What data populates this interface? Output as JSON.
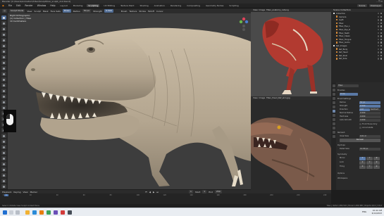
{
  "titlebar": {
    "title": "Blender [C:\\Users\\Animation\\T-Rex\\Sculpt\\trex_sculpt_v12.blend]",
    "controls": "–  ❐  ✕"
  },
  "menubar": {
    "menus": [
      "File",
      "Edit",
      "Render",
      "Window",
      "Help"
    ],
    "workspaces": [
      "Layout",
      "Modeling",
      "Sculpting",
      "UV Editing",
      "Texture Paint",
      "Shading",
      "Animation",
      "Rendering",
      "Compositing",
      "Geometry Nodes",
      "Scripting"
    ],
    "active_workspace": "Sculpting",
    "scene": "Scene",
    "view_layer": "ViewLayer"
  },
  "viewport_header": {
    "mode": "Sculpt Mode",
    "items": [
      "View",
      "Sculpt",
      "Mask",
      "Face Sets"
    ],
    "brush": "Draw",
    "radius_label": "Radius",
    "radius": "50 px",
    "strength_label": "Strength",
    "strength": "0.500",
    "right_items": [
      "Brush",
      "Texture",
      "Stroke",
      "Falloff",
      "Cursor"
    ]
  },
  "viewport_overlay": {
    "view": "Right Orthographic",
    "collection": "(1) Collection | TRex",
    "units": "10 Centimeters"
  },
  "reference_images": [
    {
      "name": "TRex_anatomy_ref.png",
      "view": "View",
      "image": "Image"
    },
    {
      "name": "TRex_Head_Ref_skin.jpg",
      "view": "View",
      "image": "Image"
    }
  ],
  "outliner": {
    "title": "Scene Collection",
    "items": [
      {
        "label": "Collection",
        "depth": 0
      },
      {
        "label": "Camera",
        "depth": 1
      },
      {
        "label": "Light",
        "depth": 1
      },
      {
        "label": "TRex",
        "depth": 1
      },
      {
        "label": "TRex_Eye_L",
        "depth": 1
      },
      {
        "label": "TRex_Eye_R",
        "depth": 1
      },
      {
        "label": "TRex_Teeth",
        "depth": 1
      },
      {
        "label": "TRex_Claws",
        "depth": 1
      },
      {
        "label": "TRex_Tongue",
        "depth": 1
      },
      {
        "label": "TRex_Gums",
        "depth": 1
      },
      {
        "label": "Ref_Images",
        "depth": 0
      },
      {
        "label": "Ref_Body",
        "depth": 1
      },
      {
        "label": "Ref_Head",
        "depth": 1
      },
      {
        "label": "Ref_Skull",
        "depth": 1
      },
      {
        "label": "Ref_Side",
        "depth": 1
      }
    ]
  },
  "properties": {
    "object_name": "TRex",
    "brush_name": "Draw",
    "sections": {
      "brushes": "Brushes",
      "brush_settings": "Brush Settings",
      "remesh": "Remesh",
      "dyntopo": "Dyntopo",
      "symmetry": "Symmetry",
      "options": "Options",
      "workspace": "Workspace"
    },
    "fields": {
      "radius_label": "Radius",
      "radius": "50 px",
      "strength_label": "Strength",
      "strength": "0.500",
      "direction_label": "Direction",
      "add": "Add",
      "subtract": "Subtract",
      "normal_radius_label": "Normal Radius",
      "normal_radius": "0.500",
      "hardness_label": "Hardness",
      "hardness": "0.000",
      "autosmooth_label": "Auto-Smooth",
      "autosmooth": "0.000",
      "front_faces": "Front Faces Only",
      "accumulate": "Accumulate",
      "voxel_size_label": "Voxel Size",
      "voxel_size": "0.01 m",
      "remesh_button": "Remesh",
      "detail_size_label": "Detail Size",
      "detail_size": "12.00 px",
      "mirror_label": "Mirror",
      "x": "X",
      "y": "Y",
      "z": "Z",
      "lock_label": "Lock",
      "tiling_label": "Tiling"
    }
  },
  "timeline": {
    "items": [
      "Playback",
      "Keying",
      "View",
      "Marker"
    ],
    "current_frame": "1",
    "start_label": "Start",
    "start": "1",
    "end_label": "End",
    "end": "250",
    "ticks": [
      "0",
      "20",
      "40",
      "60",
      "80",
      "100",
      "120",
      "140",
      "160",
      "180",
      "200",
      "220",
      "240"
    ]
  },
  "statusbar": {
    "left": "Select   ⟲ Rotate View   Sculpt Context Menu",
    "version": "TRex | Verts:1,284,516 | Faces:1,284,388 | Objects:1/12 | 3.6.2"
  },
  "taskbar": {
    "time": "10:42 AM",
    "date": "6/14/2023",
    "lang": "ENG"
  },
  "colors": {
    "accent": "#4f6b93",
    "viewport_bg": "#3d3d3d",
    "clay": "#b6a892"
  }
}
